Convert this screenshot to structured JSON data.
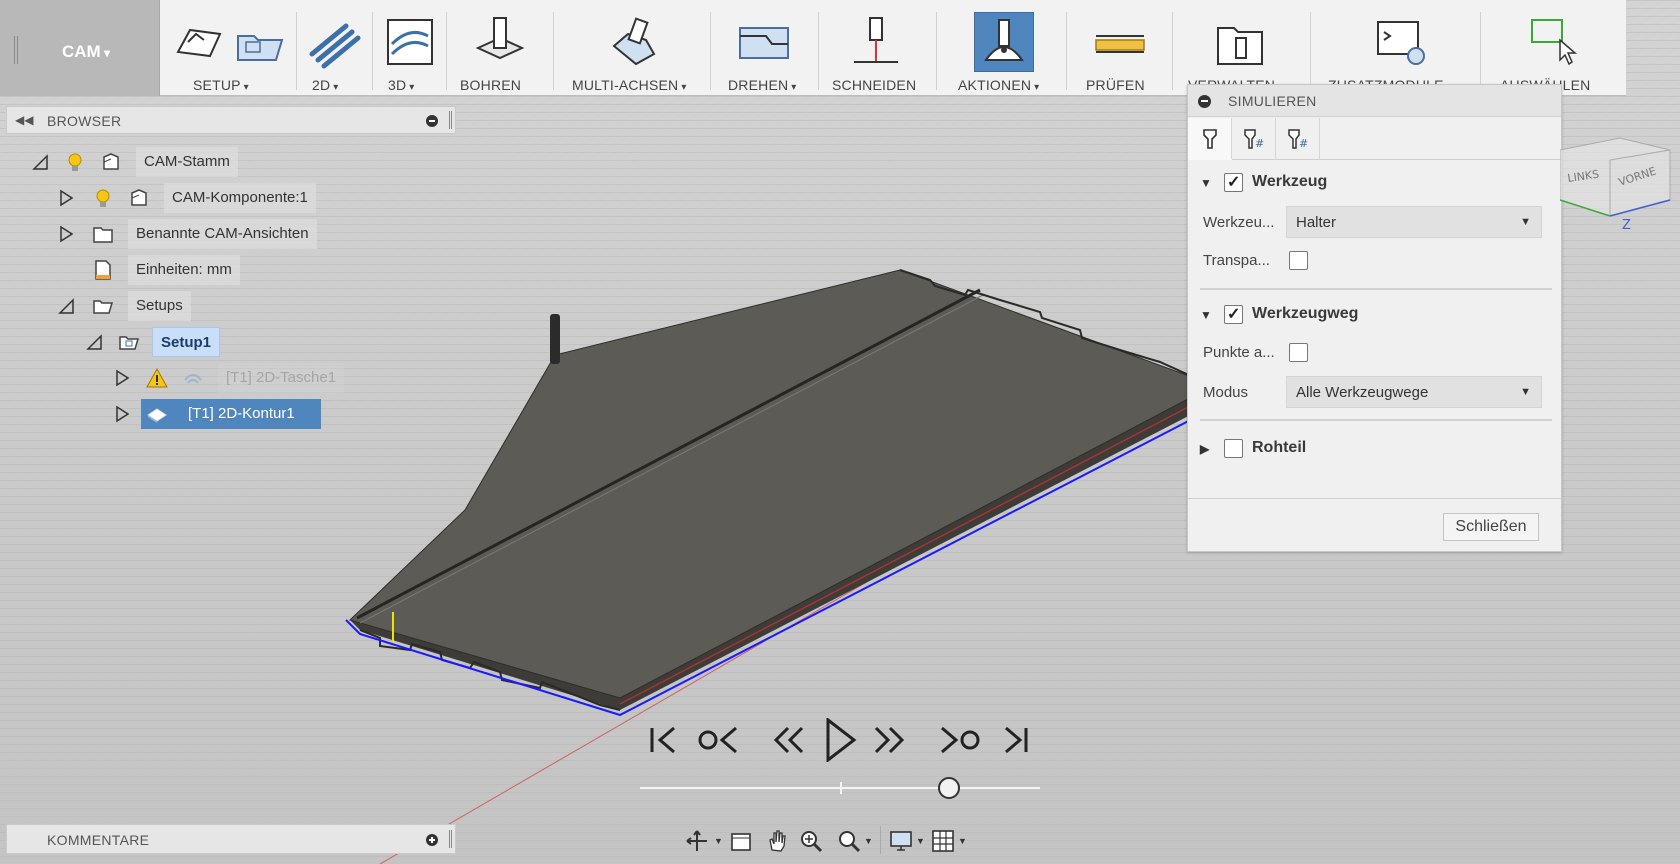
{
  "workspace": {
    "label": "CAM"
  },
  "toolbar": {
    "groups": [
      {
        "label": "SETUP",
        "has_dropdown": true
      },
      {
        "label": "2D",
        "has_dropdown": true
      },
      {
        "label": "3D",
        "has_dropdown": true
      },
      {
        "label": "BOHREN",
        "has_dropdown": false
      },
      {
        "label": "MULTI-ACHSEN",
        "has_dropdown": true
      },
      {
        "label": "DREHEN",
        "has_dropdown": true
      },
      {
        "label": "SCHNEIDEN",
        "has_dropdown": false
      },
      {
        "label": "AKTIONEN",
        "has_dropdown": true
      },
      {
        "label": "PRÜFEN",
        "has_dropdown": false
      },
      {
        "label": "VERWALTEN",
        "has_dropdown": true
      },
      {
        "label": "ZUSATZMODULE",
        "has_dropdown": true
      },
      {
        "label": "AUSWÄHLEN",
        "has_dropdown": false
      }
    ]
  },
  "browser": {
    "title": "BROWSER",
    "items": [
      {
        "label": "CAM-Stamm"
      },
      {
        "label": "CAM-Komponente:1"
      },
      {
        "label": "Benannte CAM-Ansichten"
      },
      {
        "label": "Einheiten: mm"
      },
      {
        "label": "Setups"
      },
      {
        "label": "Setup1"
      },
      {
        "label": "[T1] 2D-Tasche1"
      },
      {
        "label": "[T1] 2D-Kontur1"
      }
    ]
  },
  "simulate": {
    "title": "SIMULIEREN",
    "tool_section": {
      "title": "Werkzeug",
      "checked": true,
      "fields": [
        {
          "label": "Werkzeu...",
          "value": "Halter"
        },
        {
          "label": "Transpa...",
          "checked": false
        }
      ]
    },
    "toolpath_section": {
      "title": "Werkzeugweg",
      "checked": true,
      "fields": [
        {
          "label": "Punkte a...",
          "checked": false
        },
        {
          "label": "Modus",
          "value": "Alle Werkzeugwege"
        }
      ]
    },
    "stock_section": {
      "title": "Rohteil",
      "checked": false
    },
    "close_label": "Schließen"
  },
  "comments": {
    "title": "KOMMENTARE"
  },
  "viewcube": {
    "left_label": "LINKS",
    "front_label": "VORNE",
    "axis_label": "Z"
  },
  "playback": {
    "position": 0.75
  },
  "colors": {
    "accent": "#4f86be",
    "selected_light": "#c9dff8",
    "part": "#5c5b55",
    "toolpath": "#1a1aff"
  }
}
